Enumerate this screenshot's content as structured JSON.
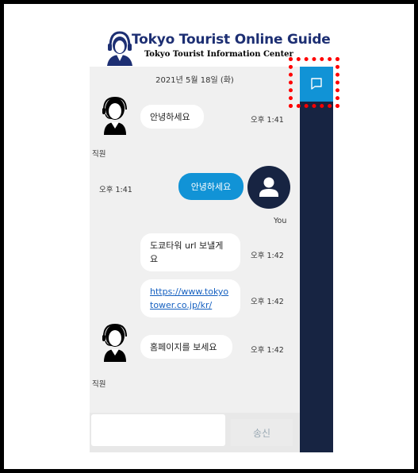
{
  "header": {
    "title": "Tokyo Tourist Online Guide",
    "subtitle": "Tokyo Tourist Information Center"
  },
  "chat": {
    "date": "2021년 5월 18일 (화)",
    "staff_label": "직원",
    "user_label": "You",
    "messages": [
      {
        "from": "staff",
        "text": "안녕하세요",
        "time": "오후 1:41"
      },
      {
        "from": "user",
        "text": "안녕하세요",
        "time": "오후 1:41"
      },
      {
        "from": "staff",
        "text": "도쿄타워 url 보낼게요",
        "time": "오후 1:42"
      },
      {
        "from": "staff",
        "text": "https://www.tokyotower.co.jp/kr/",
        "time": "오후 1:42"
      },
      {
        "from": "staff",
        "text": "홈페이지를 보세요",
        "time": "오후 1:42"
      }
    ]
  },
  "input": {
    "placeholder": "",
    "send_label": "송신"
  },
  "side_panel": {
    "chat_icon": "chat-bubble-icon"
  },
  "colors": {
    "accent": "#1193d6",
    "sidebar": "#172442",
    "highlight": "#ff0000"
  }
}
